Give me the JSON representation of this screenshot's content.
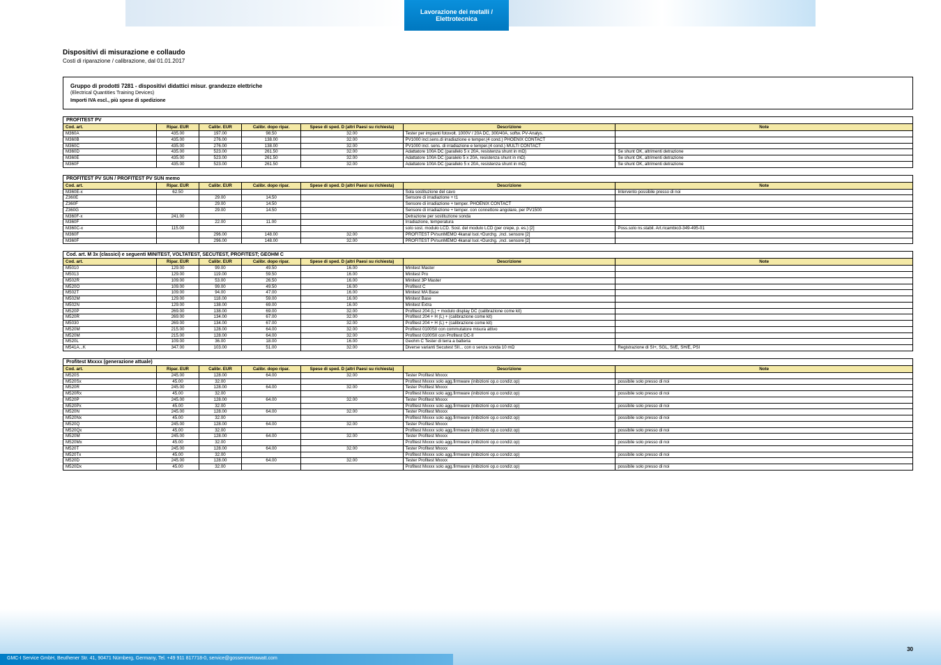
{
  "banner_tab": "Lavorazione dei metalli / Elettrotecnica",
  "title": "Dispositivi di misurazione e collaudo",
  "subtitle": "Costi di riparazione / calibrazione, dal 01.01.2017",
  "info": {
    "gp": "Gruppo di prodotti 7281 - dispositivi didattici misur. grandezze elettriche",
    "gp_sub": "(Electrical Quantities Training Devices)",
    "note": "Importi IVA escl., più spese di spedizione"
  },
  "headers": [
    "Cod. art.",
    "Ripar. EUR",
    "Calibr. EUR",
    "Calibr. dopo ripar.",
    "Spese di sped. D (altri Paesi su richiesta)",
    "Descrizione",
    "Note"
  ],
  "sections": [
    {
      "title": "PROFITEST PV",
      "rows": [
        [
          "M360A",
          "435.00",
          "197.00",
          "98.50",
          "32.00",
          "Tester per impianti fotovolt. 1000V / 20A DC, 300/40A, softw. PV-Analys.",
          ""
        ],
        [
          "M360B",
          "435.00",
          "276.00",
          "138.00",
          "32.00",
          "PV1000 incl.sens.di irradiazione e temper.(4 cond.) PHOENIX CONTACT",
          ""
        ],
        [
          "M360C",
          "435.00",
          "276.00",
          "138.00",
          "32.00",
          "PV1000 incl. sens. di irradiazione e temper.(4 cond.) MULTI CONTACT",
          ""
        ],
        [
          "M360D",
          "435.00",
          "523.00",
          "261.50",
          "32.00",
          "Adattatore 100A DC (parallelo 5 x 20A, resistenza shunt in mΩ)",
          "Se shunt OK, altrimenti detrazione"
        ],
        [
          "M360E",
          "435.00",
          "523.00",
          "261.50",
          "32.00",
          "Adattatore 100A DC (paralelo 5 x 20A, resistenza shunt in mΩ)",
          "Se shunt OK, altrimenti detrazione"
        ],
        [
          "M360F",
          "435.00",
          "523.00",
          "261.50",
          "32.00",
          "Adattatore 100A DC (parallelo 5 x 20A, resistenza shunt in mΩ)",
          "Se shunt OK, altrimenti detrazione"
        ]
      ]
    },
    {
      "title": "PROFITEST PV SUN / PROFITEST PV SUN memo",
      "rows": [
        [
          "M360E-x",
          "62.50",
          "",
          "",
          "",
          "Sola sostituzione del cavo",
          "Intervento possibile presso di noi"
        ],
        [
          "Z360E",
          "",
          "29.00",
          "14.50",
          "",
          "Sensore di irradiazione + t1",
          ""
        ],
        [
          "Z360F",
          "",
          "29.00",
          "14.50",
          "",
          "Sensore di irradiazione + temper. PHOENIX CONTACT",
          ""
        ],
        [
          "Z360G",
          "",
          "29.00",
          "14.50",
          "",
          "Sensore di irradiazione + temper. con connettore angolare, per PV1500",
          ""
        ],
        [
          "M360F-x",
          "241.00",
          "",
          "",
          "",
          "Detrazione per sostituzione sonda",
          ""
        ],
        [
          "M360F",
          "",
          "22.00",
          "11.00",
          "",
          "Irradiazione, temperatura",
          ""
        ],
        [
          "M360C-x",
          "115.00",
          "",
          "",
          "",
          "solo sost. modulo LCD. Sost. del modulo LCD (per crepe, p. es.) [2]",
          "Poss.solo ns.stabil. Art.ricambio3-349-495-01"
        ],
        [
          "M360F",
          "",
          "296.00",
          "148.00",
          "32.00",
          "PROFITEST PVsunMEMO 4kanal Isol.+Durchg. ,incl. sensore [2]",
          ""
        ],
        [
          "M360F",
          "",
          "296.00",
          "148.00",
          "32.00",
          "PROFITEST PVsunMEMO 4kanal Isol.+Durchg. ,incl. sensore [2]",
          ""
        ]
      ]
    },
    {
      "title": "Cod. art. M 3x (classici) e seguenti MINITEST, VOLTATEST, SECUTEST, PROFITEST; GEOHM C",
      "rows": [
        [
          "M5010",
          "129.00",
          "99.00",
          "49.50",
          "16.00",
          "Minitest Master",
          ""
        ],
        [
          "M5013",
          "129.00",
          "119.00",
          "59.50",
          "16.00",
          "Minitest Pro",
          ""
        ],
        [
          "M502R",
          "109.00",
          "53.00",
          "26.50",
          "16.00",
          "Minitest 3P Master",
          ""
        ],
        [
          "M520O",
          "109.00",
          "99.00",
          "49.50",
          "16.00",
          "Profitest C",
          ""
        ],
        [
          "M502T",
          "109.00",
          "94.00",
          "47.00",
          "16.00",
          "Minitest MA Base",
          ""
        ],
        [
          "M502M",
          "129.00",
          "118.00",
          "59.00",
          "16.00",
          "Minitest Base",
          ""
        ],
        [
          "M502N",
          "129.00",
          "138.00",
          "69.00",
          "16.00",
          "Minitest Extra",
          ""
        ],
        [
          "M520P",
          "269.00",
          "138.00",
          "69.00",
          "32.00",
          "Profitest 204 (L) + modulo display DC (calibrazione come kit)",
          ""
        ],
        [
          "M520R",
          "269.00",
          "134.00",
          "67.00",
          "32.00",
          "Profitest 204 + H (L) + (calibrazione come kit)",
          ""
        ],
        [
          "M5030",
          "269.00",
          "134.00",
          "67.00",
          "32.00",
          "Profitest 204 + H (L) + (calibrazione come kit)",
          ""
        ],
        [
          "M520M",
          "215.00",
          "128.00",
          "64.00",
          "32.00",
          "Profitest 0100SII con commutatore misura attivo",
          ""
        ],
        [
          "M520M",
          "215.00",
          "128.00",
          "64.00",
          "32.00",
          "Profitest 0100SII con Profitest DC-II",
          ""
        ],
        [
          "M520L",
          "109.00",
          "36.00",
          "18.00",
          "16.00",
          "Geohm C Tester di terra a batteria",
          ""
        ],
        [
          "M541A...K",
          "347.00",
          "103.00",
          "51.00",
          "32.00",
          "Diverse varianti Secutest SII... con o senza sonda 10 mΩ",
          "Registrazione di SI+, SGL, SI/E, SH/E, PSI"
        ]
      ]
    },
    {
      "title": "Profitest Mxxxx (generazione attuale)",
      "rows": [
        [
          "M520S",
          "245.00",
          "128.00",
          "64.00",
          "32.00",
          "Tester Profitest Mxxxx",
          ""
        ],
        [
          "M520Sx",
          "45.00",
          "32.00",
          "",
          "",
          "Profitest Mxxxx solo agg.firmware (inibizioni op.o condiz.op)",
          "possibile solo presso di noi"
        ],
        [
          "M520R",
          "245.00",
          "128.00",
          "64.00",
          "32.00",
          "Tester Profitest Mxxxx",
          ""
        ],
        [
          "M520Rx",
          "45.00",
          "32.00",
          "",
          "",
          "Profitest Mxxxx solo agg.firmware (inibizioni op.o condiz.op)",
          "possibile solo presso di noi"
        ],
        [
          "M520P",
          "245.00",
          "128.00",
          "64.00",
          "32.00",
          "Tester Profitest Mxxxx",
          ""
        ],
        [
          "M520Px",
          "45.00",
          "32.00",
          "",
          "",
          "Profitest Mxxxx solo agg.firmware (inibizioni op.o condiz.op)",
          "possibile solo presso di noi"
        ],
        [
          "M520N",
          "245.00",
          "128.00",
          "64.00",
          "32.00",
          "Tester Profitest Mxxxx",
          ""
        ],
        [
          "M520Nx",
          "45.00",
          "32.00",
          "",
          "",
          "Profitest Mxxxx solo agg.firmware (inibizioni op.o condiz.op)",
          "possibile solo presso di noi"
        ],
        [
          "M520Q",
          "245.00",
          "128.00",
          "64.00",
          "32.00",
          "Tester Profitest Mxxxx",
          ""
        ],
        [
          "M520Qx",
          "45.00",
          "32.00",
          "",
          "",
          "Profitest Mxxxx solo agg.firmware (inibizioni op.o condiz.op)",
          "possibile solo presso di noi"
        ],
        [
          "M520M",
          "245.00",
          "128.00",
          "64.00",
          "32.00",
          "Tester Profitest Mxxxx",
          ""
        ],
        [
          "M520Mx",
          "45.00",
          "32.00",
          "",
          "",
          "Profitest Mxxxx solo agg.firmware (inibizioni op.o condiz.op)",
          "possibile solo presso di noi"
        ],
        [
          "M520T",
          "245.00",
          "128.00",
          "64.00",
          "32.00",
          "Tester Profitest Mxxxx",
          ""
        ],
        [
          "M520Tx",
          "45.00",
          "32.00",
          "",
          "",
          "Profitest Mxxxx solo agg.firmware (inibizioni op.o condiz.op)",
          "possibile solo presso di noi"
        ],
        [
          "M520D",
          "245.00",
          "128.00",
          "64.00",
          "32.00",
          "Tester Profitest Mxxxx",
          ""
        ],
        [
          "M520Dx",
          "45.00",
          "32.00",
          "",
          "",
          "Profitest Mxxxx solo agg.firmware (inibizioni op.o condiz.op)",
          "possibile solo presso di noi"
        ]
      ]
    }
  ],
  "footer_text": "GMC-I Service GmbH, Beuthener Str. 41, 90471 Nürnberg, Germany, Tel. +49 911 817718-0, service@gossenmetrawatt.com",
  "page_number": "30"
}
